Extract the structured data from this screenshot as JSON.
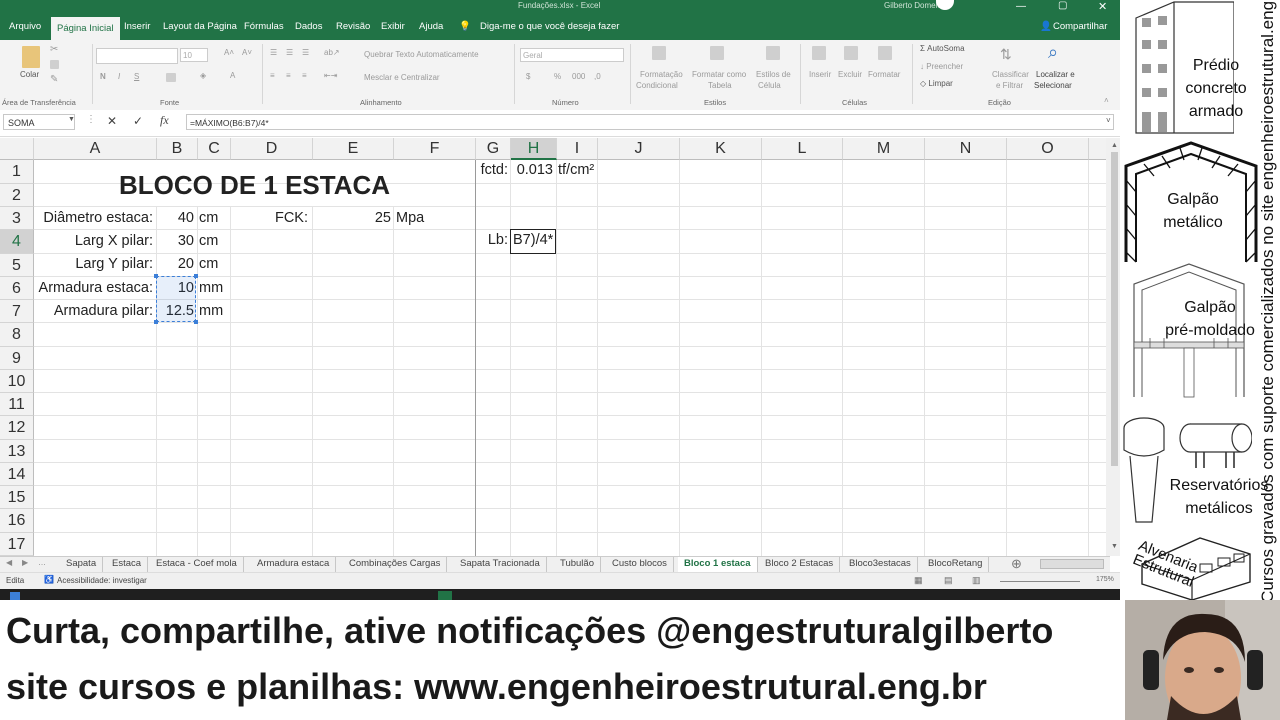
{
  "excel": {
    "title_center": "Fundações.xlsx - Excel",
    "user": "Gilberto Domeles",
    "ribbon_tabs": [
      "Arquivo",
      "Página Inicial",
      "Inserir",
      "Layout da Página",
      "Fórmulas",
      "Dados",
      "Revisão",
      "Exibir",
      "Ajuda"
    ],
    "tell_me": "Diga-me o que você deseja fazer",
    "share": "Compartilhar",
    "groups": {
      "clipboard": "Área de Transferência",
      "font": "Fonte",
      "alignment": "Alinhamento",
      "number": "Número",
      "styles": "Estilos",
      "cells": "Células",
      "editing": "Edição"
    },
    "ribbon_buttons": {
      "paste": "Colar",
      "font_size": "10",
      "wrap_text": "Quebrar Texto Automaticamente",
      "merge_center": "Mesclar e Centralizar",
      "number_format": "Geral",
      "cond_format_1": "Formatação",
      "cond_format_2": "Condicional",
      "format_table_1": "Formatar como",
      "format_table_2": "Tabela",
      "cell_styles_1": "Estilos de",
      "cell_styles_2": "Célula",
      "insert": "Inserir",
      "delete": "Excluir",
      "format": "Formatar",
      "autosum": "AutoSoma",
      "fill": "Preencher",
      "clear": "Limpar",
      "sort_1": "Classificar",
      "sort_2": "e Filtrar",
      "find_1": "Localizar e",
      "find_2": "Selecionar"
    },
    "name_box": "SOMA",
    "formula": "=MÁXIMO(B6:B7)/4*",
    "columns": [
      "A",
      "B",
      "C",
      "D",
      "E",
      "F",
      "G",
      "H",
      "I",
      "J",
      "K",
      "L",
      "M",
      "N",
      "O"
    ],
    "selected_column": "H",
    "rows": [
      "1",
      "2",
      "3",
      "4",
      "5",
      "6",
      "7",
      "8",
      "9",
      "10",
      "11",
      "12",
      "13",
      "14",
      "15",
      "16",
      "17"
    ],
    "selected_row": "4",
    "cells": {
      "title": "BLOCO DE 1 ESTACA",
      "a3": "Diâmetro estaca:",
      "b3": "40",
      "c3": "cm",
      "d3": "FCK:",
      "e3": "25",
      "f3": "Mpa",
      "a4": "Larg X pilar:",
      "b4": "30",
      "c4": "cm",
      "a5": "Larg Y pilar:",
      "b5": "20",
      "c5": "cm",
      "a6": "Armadura estaca:",
      "b6": "10",
      "c6": "mm",
      "a7": "Armadura pilar:",
      "b7": "12.5",
      "c7": "mm",
      "g1": "fctd:",
      "h1": "0.013",
      "i1": "tf/cm²",
      "g4": "Lb:",
      "h4": "B7)/4*"
    },
    "sheet_tabs": [
      "Sapata",
      "Estaca",
      "Estaca - Coef mola",
      "Armadura estaca",
      "Combinações Cargas",
      "Sapata Tracionada",
      "Tubulão",
      "Custo blocos",
      "Bloco 1 estaca",
      "Bloco 2 Estacas",
      "Bloco3estacas",
      "BlocoRetang"
    ],
    "active_sheet": "Bloco 1 estaca",
    "status_left": "Edita",
    "status_access": "Acessibilidade: investigar",
    "zoom": "175%"
  },
  "banner": {
    "line1": "Curta, compartilhe, ative notificações @engestruturalgilberto",
    "line2": "site cursos e planilhas: www.engenheiroestrutural.eng.br"
  },
  "side_panel": {
    "item1": [
      "Prédio",
      "concreto",
      "armado"
    ],
    "item2": [
      "Galpão",
      "metálico"
    ],
    "item3": [
      "Galpão",
      "pré-moldado"
    ],
    "item4": [
      "Reservatórios",
      "metálicos"
    ],
    "item5": [
      "Alvenaria",
      "Estrutural"
    ],
    "vertical_text": "Cursos gravados com suporte comercializados no site engenheiroestrutural.eng.br"
  },
  "colors": {
    "excel_green": "#217346",
    "selection_blue": "#3c7fd8"
  }
}
